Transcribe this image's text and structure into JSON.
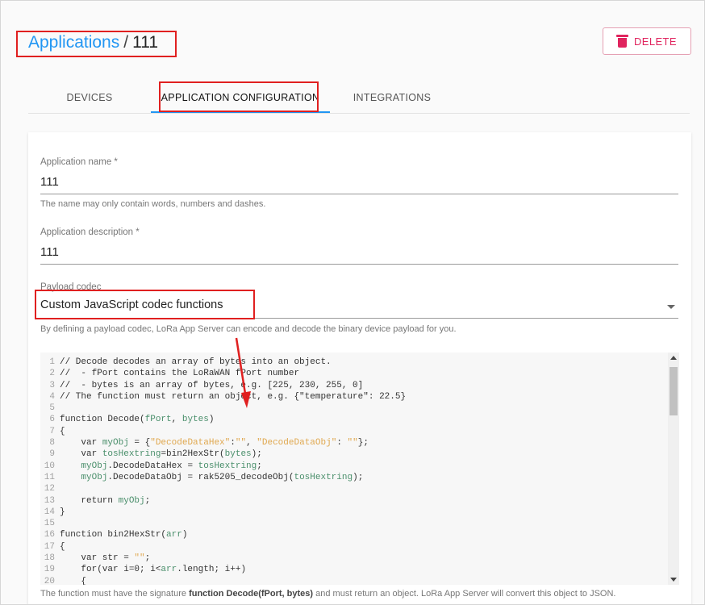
{
  "breadcrumb": {
    "parent": "Applications",
    "separator": "/",
    "current": "111"
  },
  "header": {
    "delete_label": "DELETE"
  },
  "tabs": [
    {
      "label": "DEVICES"
    },
    {
      "label": "APPLICATION CONFIGURATION"
    },
    {
      "label": "INTEGRATIONS"
    }
  ],
  "form": {
    "name_label": "Application name *",
    "name_value": "111",
    "name_helper": "The name may only contain words, numbers and dashes.",
    "description_label": "Application description *",
    "description_value": "111",
    "codec_label": "Payload codec",
    "codec_value": "Custom JavaScript codec functions",
    "codec_helper": "By defining a payload codec, LoRa App Server can encode and decode the binary device payload for you."
  },
  "code": {
    "lines": [
      {
        "n": "1",
        "text": "// Decode decodes an array of bytes into an object."
      },
      {
        "n": "2",
        "text": "//  - fPort contains the LoRaWAN fPort number"
      },
      {
        "n": "3",
        "text": "//  - bytes is an array of bytes, e.g. [225, 230, 255, 0]"
      },
      {
        "n": "4",
        "text": "// The function must return an object, e.g. {\"temperature\": 22.5}"
      },
      {
        "n": "5",
        "text": ""
      },
      {
        "n": "6",
        "text": "function Decode(fPort, bytes)"
      },
      {
        "n": "7",
        "text": "{"
      },
      {
        "n": "8",
        "text": "    var myObj = {\"DecodeDataHex\":\"\", \"DecodeDataObj\": \"\"};"
      },
      {
        "n": "9",
        "text": "    var tosHextring=bin2HexStr(bytes);"
      },
      {
        "n": "10",
        "text": "    myObj.DecodeDataHex = tosHextring;"
      },
      {
        "n": "11",
        "text": "    myObj.DecodeDataObj = rak5205_decodeObj(tosHextring);"
      },
      {
        "n": "12",
        "text": ""
      },
      {
        "n": "13",
        "text": "    return myObj;"
      },
      {
        "n": "14",
        "text": "}"
      },
      {
        "n": "15",
        "text": ""
      },
      {
        "n": "16",
        "text": "function bin2HexStr(arr)"
      },
      {
        "n": "17",
        "text": "{"
      },
      {
        "n": "18",
        "text": "    var str = \"\";"
      },
      {
        "n": "19",
        "text": "    for(var i=0; i<arr.length; i++)"
      },
      {
        "n": "20",
        "text": "    {"
      }
    ]
  },
  "footer": {
    "prefix": "The function must have the signature ",
    "signature": "function Decode(fPort, bytes)",
    "suffix": " and must return an object. LoRa App Server will convert this object to JSON."
  },
  "colors": {
    "accent": "#2196f3",
    "danger": "#e0245e",
    "highlight": "#e02020"
  }
}
